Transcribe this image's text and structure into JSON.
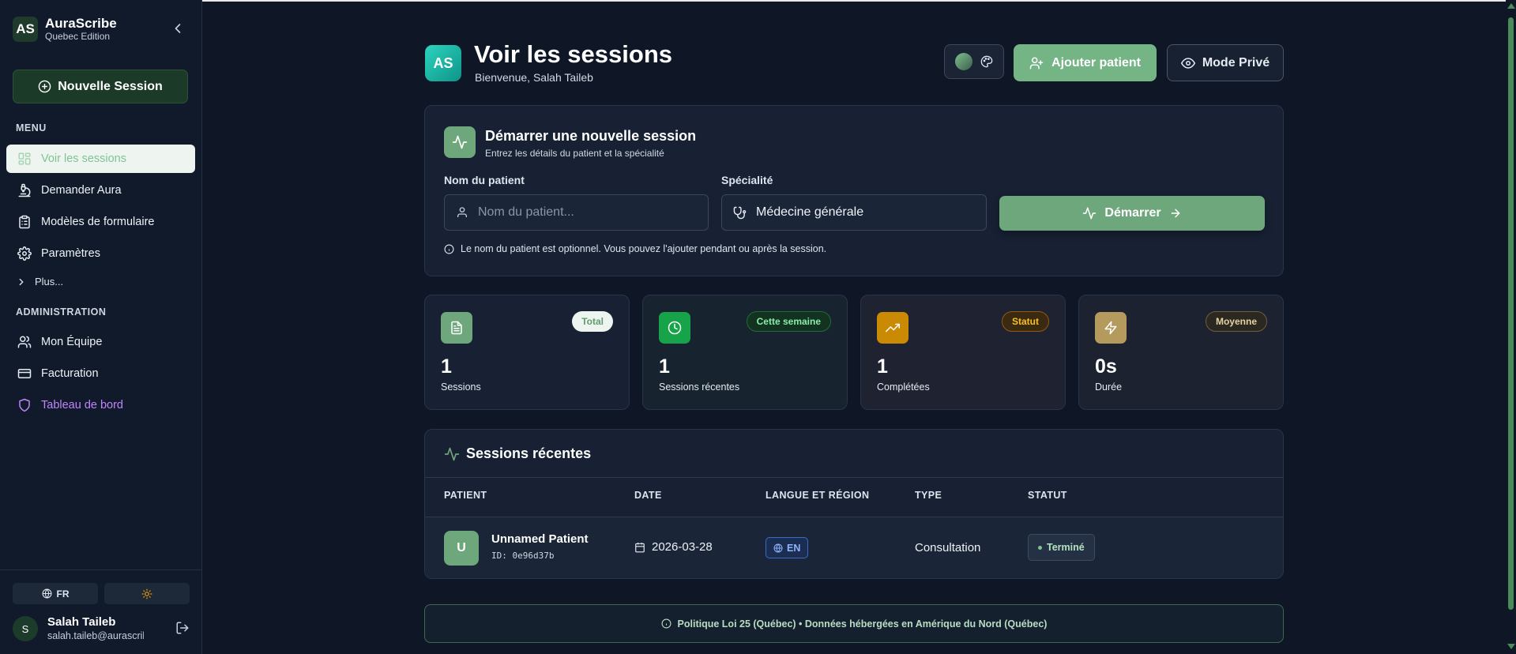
{
  "colors": {
    "accent": "#6fa77d",
    "background": "#0f1727",
    "sidebar": "#111a2b",
    "admin_link": "#c084fc"
  },
  "brand": {
    "logo": "AS",
    "name": "AuraScribe",
    "edition": "Quebec Edition"
  },
  "sidebar": {
    "new_session": "Nouvelle Session",
    "menu_title": "MENU",
    "items": [
      {
        "label": "Voir les sessions",
        "icon": "dashboard-icon"
      },
      {
        "label": "Demander Aura",
        "icon": "microscope-icon"
      },
      {
        "label": "Modèles de formulaire",
        "icon": "clipboard-icon"
      },
      {
        "label": "Paramètres",
        "icon": "gear-icon"
      }
    ],
    "more": "Plus...",
    "admin_title": "ADMINISTRATION",
    "admin_items": [
      {
        "label": "Mon Équipe",
        "icon": "users-icon"
      },
      {
        "label": "Facturation",
        "icon": "credit-card-icon"
      },
      {
        "label": "Tableau de bord",
        "icon": "shield-icon"
      }
    ],
    "language": "FR",
    "user": {
      "initial": "S",
      "name": "Salah Taileb",
      "email": "salah.taileb@aurascribe...."
    }
  },
  "header": {
    "logo": "AS",
    "title": "Voir les sessions",
    "subtitle": "Bienvenue, Salah Taileb",
    "add_patient": "Ajouter patient",
    "private_mode": "Mode Privé"
  },
  "start": {
    "title": "Démarrer une nouvelle session",
    "subtitle": "Entrez les détails du patient et la spécialité",
    "patient_label": "Nom du patient",
    "patient_placeholder": "Nom du patient...",
    "specialty_label": "Spécialité",
    "specialty_value": "Médecine générale",
    "start_button": "Démarrer",
    "note": "Le nom du patient est optionnel. Vous pouvez l'ajouter pendant ou après la session."
  },
  "stats": [
    {
      "badge": "Total",
      "value": "1",
      "label": "Sessions",
      "icon": "document-icon"
    },
    {
      "badge": "Cette semaine",
      "value": "1",
      "label": "Sessions récentes",
      "icon": "clock-icon"
    },
    {
      "badge": "Statut",
      "value": "1",
      "label": "Complétées",
      "icon": "trending-up-icon"
    },
    {
      "badge": "Moyenne",
      "value": "0s",
      "label": "Durée",
      "icon": "lightning-icon"
    }
  ],
  "recent": {
    "title": "Sessions récentes",
    "columns": [
      "PATIENT",
      "DATE",
      "LANGUE ET RÉGION",
      "TYPE",
      "STATUT"
    ],
    "rows": [
      {
        "initial": "U",
        "name": "Unnamed Patient",
        "id": "ID: 0e96d37b",
        "date": "2026-03-28",
        "lang": "EN",
        "type": "Consultation",
        "status": "Terminé"
      }
    ]
  },
  "footer": "Politique Loi 25 (Québec) • Données hébergées en Amérique du Nord (Québec)"
}
